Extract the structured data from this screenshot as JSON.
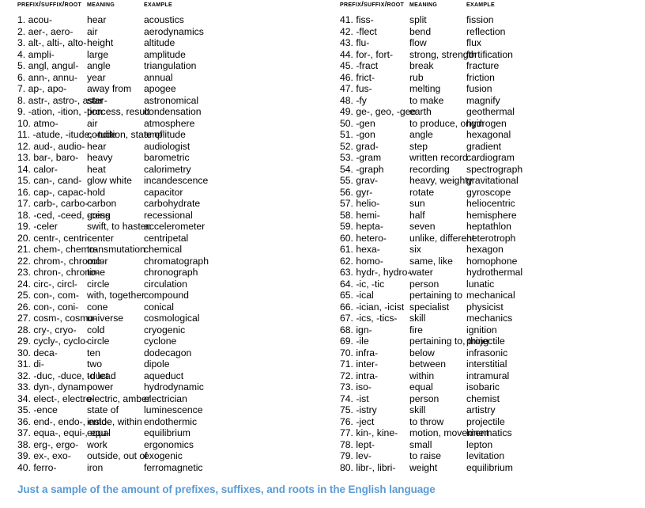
{
  "headers": {
    "term": "Prefix/Suffix/Root",
    "meaning": "Meaning",
    "example": "Example"
  },
  "footnote": "Just a sample of the amount of prefixes, suffixes, and roots in the English language",
  "colors": {
    "text": "#000000",
    "footnote": "#5b9bd5",
    "background": "#ffffff"
  },
  "left_column": [
    {
      "n": "1.",
      "term": "acou-",
      "meaning": "hear",
      "example": "acoustics"
    },
    {
      "n": "2.",
      "term": "aer-, aero-",
      "meaning": "air",
      "example": "aerodynamics"
    },
    {
      "n": "3.",
      "term": "alt-, alti-, alto-",
      "meaning": "height",
      "example": "altitude"
    },
    {
      "n": "4.",
      "term": "ampli-",
      "meaning": "large",
      "example": "amplitude"
    },
    {
      "n": "5.",
      "term": "angl, angul-",
      "meaning": "angle",
      "example": "triangulation"
    },
    {
      "n": "6.",
      "term": "ann-, annu-",
      "meaning": "year",
      "example": "annual"
    },
    {
      "n": "7.",
      "term": "ap-, apo-",
      "meaning": "away from",
      "example": "apogee"
    },
    {
      "n": "8.",
      "term": "astr-, astro-, aster-",
      "meaning": "star",
      "example": "astronomical"
    },
    {
      "n": "9.",
      "term": "-ation, -ition, -tion",
      "meaning": "process, result",
      "example": "condensation"
    },
    {
      "n": "10.",
      "term": "atmo-",
      "meaning": "air",
      "example": "atmosphere"
    },
    {
      "n": "11.",
      "term": "-atude, -itude, -tude",
      "meaning": "condition, state of",
      "example": "amplitude"
    },
    {
      "n": "12.",
      "term": "aud-, audio-",
      "meaning": "hear",
      "example": "audiologist"
    },
    {
      "n": "13.",
      "term": "bar-, baro-",
      "meaning": "heavy",
      "example": "barometric"
    },
    {
      "n": "14.",
      "term": "calor-",
      "meaning": "heat",
      "example": "calorimetry"
    },
    {
      "n": "15.",
      "term": "can-, cand-",
      "meaning": "glow white",
      "example": "incandescence"
    },
    {
      "n": "16.",
      "term": "cap-, capac-",
      "meaning": "hold",
      "example": "capacitor"
    },
    {
      "n": "17.",
      "term": "carb-, carbo-",
      "meaning": "carbon",
      "example": "carbohydrate"
    },
    {
      "n": "18.",
      "term": "-ced, -ceed, -cess",
      "meaning": "going",
      "example": "recessional"
    },
    {
      "n": "19.",
      "term": "-celer",
      "meaning": "swift, to hasten",
      "example": "accelerometer"
    },
    {
      "n": "20.",
      "term": "centr-, centri-",
      "meaning": "center",
      "example": "centripetal"
    },
    {
      "n": "21.",
      "term": "chem-, chemo-",
      "meaning": "transmutation",
      "example": "chemical"
    },
    {
      "n": "22.",
      "term": "chrom-, chromo-",
      "meaning": "color",
      "example": "chromatograph"
    },
    {
      "n": "23.",
      "term": "chron-, chrono-",
      "meaning": "time",
      "example": "chronograph"
    },
    {
      "n": "24.",
      "term": "circ-, circl-",
      "meaning": "circle",
      "example": "circulation"
    },
    {
      "n": "25.",
      "term": "con-, com-",
      "meaning": "with, together",
      "example": "compound"
    },
    {
      "n": "26.",
      "term": "con-, coni-",
      "meaning": "cone",
      "example": "conical"
    },
    {
      "n": "27.",
      "term": "cosm-, cosmo-",
      "meaning": "universe",
      "example": "cosmological"
    },
    {
      "n": "28.",
      "term": "cry-, cryo-",
      "meaning": "cold",
      "example": "cryogenic"
    },
    {
      "n": "29.",
      "term": "cycly-, cyclo-",
      "meaning": "circle",
      "example": "cyclone"
    },
    {
      "n": "30.",
      "term": "deca-",
      "meaning": "ten",
      "example": "dodecagon"
    },
    {
      "n": "31.",
      "term": "di-",
      "meaning": "two",
      "example": "dipole"
    },
    {
      "n": "32.",
      "term": "-duc, -duce, -duct",
      "meaning": "to lead",
      "example": "aqueduct"
    },
    {
      "n": "33.",
      "term": "dyn-, dynam-",
      "meaning": "power",
      "example": "hydrodynamic"
    },
    {
      "n": "34.",
      "term": "elect-, electro-",
      "meaning": "electric, amber",
      "example": "electrician"
    },
    {
      "n": "35.",
      "term": "-ence",
      "meaning": "state of",
      "example": "luminescence"
    },
    {
      "n": "36.",
      "term": "end-, endo-, ento-",
      "meaning": "inside, within",
      "example": "endothermic"
    },
    {
      "n": "37.",
      "term": "equa-, equi-, equ-",
      "meaning": "equal",
      "example": "equilibrium"
    },
    {
      "n": "38.",
      "term": "erg-, ergo-",
      "meaning": "work",
      "example": "ergonomics"
    },
    {
      "n": "39.",
      "term": "ex-, exo-",
      "meaning": "outside, out of",
      "example": "exogenic"
    },
    {
      "n": "40.",
      "term": "ferro-",
      "meaning": "iron",
      "example": "ferromagnetic"
    }
  ],
  "right_column": [
    {
      "n": "41.",
      "term": "fiss-",
      "meaning": "split",
      "example": "fission"
    },
    {
      "n": "42.",
      "term": "-flect",
      "meaning": "bend",
      "example": "reflection"
    },
    {
      "n": "43.",
      "term": "flu-",
      "meaning": "flow",
      "example": "flux"
    },
    {
      "n": "44.",
      "term": "for-, fort-",
      "meaning": "strong, strength",
      "example": "fortification"
    },
    {
      "n": "45.",
      "term": "-fract",
      "meaning": "break",
      "example": "fracture"
    },
    {
      "n": "46.",
      "term": "frict-",
      "meaning": "rub",
      "example": "friction"
    },
    {
      "n": "47.",
      "term": "fus-",
      "meaning": "melting",
      "example": "fusion"
    },
    {
      "n": "48.",
      "term": "-fy",
      "meaning": "to make",
      "example": "magnify"
    },
    {
      "n": "49.",
      "term": "ge-, geo, -gee",
      "meaning": "earth",
      "example": "geothermal"
    },
    {
      "n": "50.",
      "term": "-gen",
      "meaning": "to produce, origin",
      "example": "hydrogen"
    },
    {
      "n": "51.",
      "term": "-gon",
      "meaning": "angle",
      "example": "hexagonal"
    },
    {
      "n": "52.",
      "term": "grad-",
      "meaning": "step",
      "example": "gradient"
    },
    {
      "n": "53.",
      "term": "-gram",
      "meaning": "written record",
      "example": "cardiogram"
    },
    {
      "n": "54.",
      "term": "-graph",
      "meaning": "recording",
      "example": "spectrograph"
    },
    {
      "n": "55.",
      "term": "grav-",
      "meaning": "heavy, weighty",
      "example": "gravitational"
    },
    {
      "n": "56.",
      "term": "gyr-",
      "meaning": "rotate",
      "example": "gyroscope"
    },
    {
      "n": "57.",
      "term": "helio-",
      "meaning": "sun",
      "example": "heliocentric"
    },
    {
      "n": "58.",
      "term": "hemi-",
      "meaning": "half",
      "example": "hemisphere"
    },
    {
      "n": "59.",
      "term": "hepta-",
      "meaning": "seven",
      "example": "heptathlon"
    },
    {
      "n": "60.",
      "term": "hetero-",
      "meaning": "unlike, different",
      "example": "heterotroph"
    },
    {
      "n": "61.",
      "term": "hexa-",
      "meaning": "six",
      "example": "hexagon"
    },
    {
      "n": "62.",
      "term": "homo-",
      "meaning": "same, like",
      "example": "homophone"
    },
    {
      "n": "63.",
      "term": "hydr-, hydro-",
      "meaning": "water",
      "example": "hydrothermal"
    },
    {
      "n": "64.",
      "term": "-ic, -tic",
      "meaning": "person",
      "example": "lunatic"
    },
    {
      "n": "65.",
      "term": "-ical",
      "meaning": "pertaining to",
      "example": "mechanical"
    },
    {
      "n": "66.",
      "term": "-ician, -icist",
      "meaning": "specialist",
      "example": "physicist"
    },
    {
      "n": "67.",
      "term": "-ics, -tics-",
      "meaning": "skill",
      "example": "mechanics"
    },
    {
      "n": "68.",
      "term": "ign-",
      "meaning": "fire",
      "example": "ignition"
    },
    {
      "n": "69.",
      "term": "-ile",
      "meaning": "pertaining to, thing",
      "example": "projectile"
    },
    {
      "n": "70.",
      "term": "infra-",
      "meaning": "below",
      "example": "infrasonic"
    },
    {
      "n": "71.",
      "term": "inter-",
      "meaning": "between",
      "example": "interstitial"
    },
    {
      "n": "72.",
      "term": "intra-",
      "meaning": "within",
      "example": "intramural"
    },
    {
      "n": "73.",
      "term": "iso-",
      "meaning": "equal",
      "example": "isobaric"
    },
    {
      "n": "74.",
      "term": "-ist",
      "meaning": "person",
      "example": "chemist"
    },
    {
      "n": "75.",
      "term": "-istry",
      "meaning": "skill",
      "example": "artistry"
    },
    {
      "n": "76.",
      "term": "-ject",
      "meaning": "to throw",
      "example": "projectile"
    },
    {
      "n": "77.",
      "term": "kin-, kine-",
      "meaning": "motion, movement",
      "example": "kinematics"
    },
    {
      "n": "78.",
      "term": "lept-",
      "meaning": "small",
      "example": "lepton"
    },
    {
      "n": "79.",
      "term": "lev-",
      "meaning": "to raise",
      "example": "levitation"
    },
    {
      "n": "80.",
      "term": "libr-, libri-",
      "meaning": "weight",
      "example": "equilibrium"
    }
  ]
}
